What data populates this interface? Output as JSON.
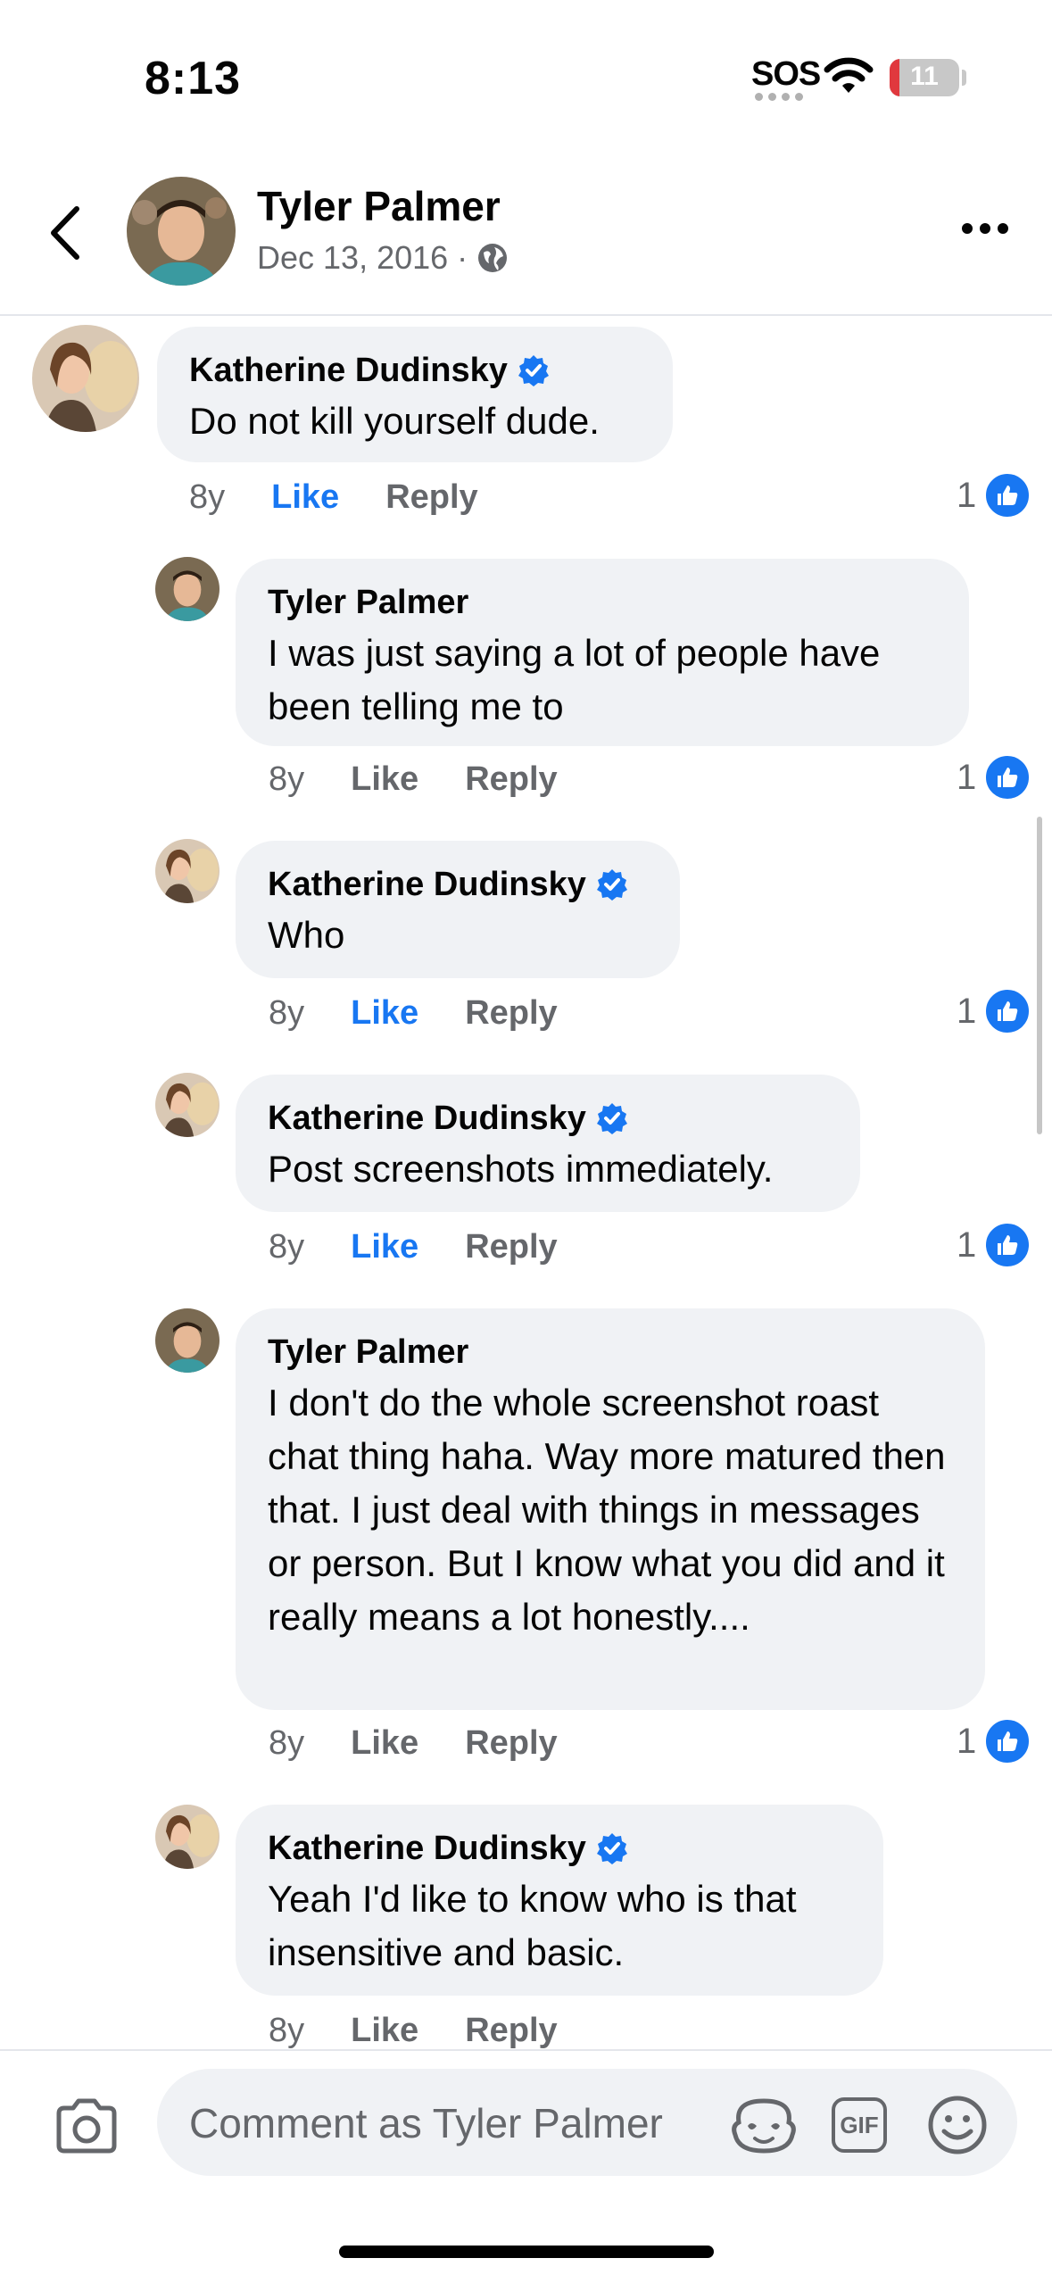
{
  "status": {
    "time": "8:13",
    "sos": "SOS",
    "battery": "11",
    "battery_level": 0.11
  },
  "header": {
    "name": "Tyler Palmer",
    "date": "Dec 13, 2016",
    "separator": "·",
    "privacy_icon": "globe-icon"
  },
  "comments": [
    {
      "author": "Katherine Dudinsky",
      "verified": true,
      "text": "Do not kill yourself dude.",
      "age": "8y",
      "like": "Like",
      "reply": "Reply",
      "liked": true,
      "likes": "1"
    },
    {
      "author": "Tyler Palmer",
      "verified": false,
      "text": "I was just saying a lot of people have been telling me to",
      "age": "8y",
      "like": "Like",
      "reply": "Reply",
      "liked": false,
      "likes": "1"
    },
    {
      "author": "Katherine Dudinsky",
      "verified": true,
      "text": "Who",
      "age": "8y",
      "like": "Like",
      "reply": "Reply",
      "liked": true,
      "likes": "1"
    },
    {
      "author": "Katherine Dudinsky",
      "verified": true,
      "text": "Post screenshots immediately.",
      "age": "8y",
      "like": "Like",
      "reply": "Reply",
      "liked": true,
      "likes": "1"
    },
    {
      "author": "Tyler Palmer",
      "verified": false,
      "text": "I don't do the whole screenshot roast chat thing haha. Way more matured then that. I just deal with things in messages or person. But I know what you did and it really means a lot honestly....",
      "age": "8y",
      "like": "Like",
      "reply": "Reply",
      "liked": false,
      "likes": "1"
    },
    {
      "author": "Katherine Dudinsky",
      "verified": true,
      "text": "Yeah I'd like to know who is that insensitive and basic.",
      "age": "8y",
      "like": "Like",
      "reply": "Reply",
      "liked": false,
      "likes": ""
    }
  ],
  "composer": {
    "placeholder": "Comment as Tyler Palmer",
    "gif": "GIF"
  },
  "colors": {
    "accent": "#1877f2",
    "bubble": "#f0f2f5",
    "muted": "#65676b"
  }
}
